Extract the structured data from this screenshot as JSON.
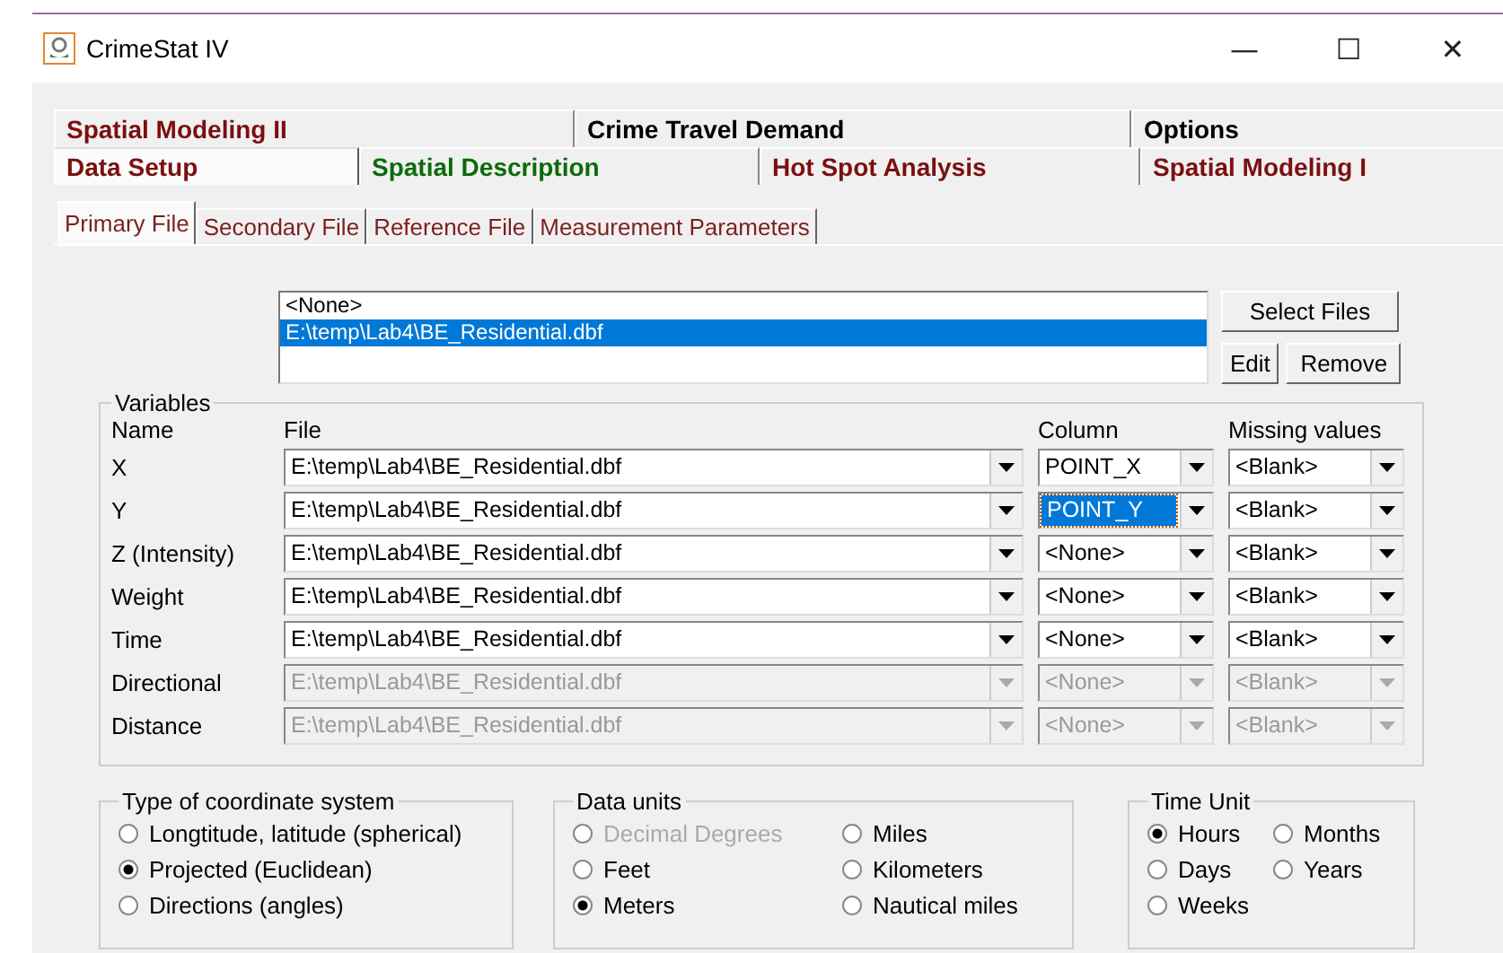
{
  "window": {
    "title": "CrimeStat IV",
    "controls": [
      "—",
      "☐",
      "✕"
    ]
  },
  "main_tabs": [
    [
      {
        "label": "Spatial Modeling II",
        "color": "#7b0f0f",
        "selected": false
      },
      {
        "label": "Crime Travel Demand",
        "color": "#000000",
        "selected": false
      },
      {
        "label": "Options",
        "color": "#000000",
        "selected": false
      }
    ],
    [
      {
        "label": "Data Setup",
        "color": "#7b0f0f",
        "selected": true
      },
      {
        "label": "Spatial Description",
        "color": "#0b6b0b",
        "selected": false
      },
      {
        "label": "Hot Spot Analysis",
        "color": "#7b0f0f",
        "selected": false
      },
      {
        "label": "Spatial Modeling I",
        "color": "#7b0f0f",
        "selected": false
      }
    ]
  ],
  "sub_tabs": [
    {
      "label": "Primary File",
      "selected": true
    },
    {
      "label": "Secondary File",
      "selected": false
    },
    {
      "label": "Reference File",
      "selected": false
    },
    {
      "label": "Measurement Parameters",
      "selected": false
    }
  ],
  "file_list": [
    {
      "label": "<None>",
      "selected": false
    },
    {
      "label": "E:\\temp\\Lab4\\BE_Residential.dbf",
      "selected": true
    }
  ],
  "file_buttons": [
    "Select Files",
    "Edit",
    "Remove"
  ],
  "variables": {
    "title": "Variables",
    "headers": [
      "Name",
      "File",
      "Column",
      "Missing values"
    ],
    "rows": [
      {
        "name": "X",
        "file": "E:\\temp\\Lab4\\BE_Residential.dbf",
        "column": "POINT_X",
        "missing": "<Blank>",
        "disabled": false,
        "column_focused": false
      },
      {
        "name": "Y",
        "file": "E:\\temp\\Lab4\\BE_Residential.dbf",
        "column": "POINT_Y",
        "missing": "<Blank>",
        "disabled": false,
        "column_focused": true
      },
      {
        "name": "Z (Intensity)",
        "file": "E:\\temp\\Lab4\\BE_Residential.dbf",
        "column": "<None>",
        "missing": "<Blank>",
        "disabled": false,
        "column_focused": false
      },
      {
        "name": "Weight",
        "file": "E:\\temp\\Lab4\\BE_Residential.dbf",
        "column": "<None>",
        "missing": "<Blank>",
        "disabled": false,
        "column_focused": false
      },
      {
        "name": "Time",
        "file": "E:\\temp\\Lab4\\BE_Residential.dbf",
        "column": "<None>",
        "missing": "<Blank>",
        "disabled": false,
        "column_focused": false
      },
      {
        "name": "Directional",
        "file": "E:\\temp\\Lab4\\BE_Residential.dbf",
        "column": "<None>",
        "missing": "<Blank>",
        "disabled": true,
        "column_focused": false
      },
      {
        "name": "Distance",
        "file": "E:\\temp\\Lab4\\BE_Residential.dbf",
        "column": "<None>",
        "missing": "<Blank>",
        "disabled": true,
        "column_focused": false
      }
    ]
  },
  "option_groups": [
    {
      "title": "Type of coordinate system",
      "options": [
        {
          "label": "Longtitude, latitude (spherical)",
          "selected": false,
          "disabled": false
        },
        {
          "label": "Projected (Euclidean)",
          "selected": true,
          "disabled": false
        },
        {
          "label": "Directions (angles)",
          "selected": false,
          "disabled": false
        }
      ]
    },
    {
      "title": "Data units",
      "options": [
        {
          "label": "Decimal Degrees",
          "selected": false,
          "disabled": true
        },
        {
          "label": "Miles",
          "selected": false,
          "disabled": false
        },
        {
          "label": "Feet",
          "selected": false,
          "disabled": false
        },
        {
          "label": "Kilometers",
          "selected": false,
          "disabled": false
        },
        {
          "label": "Meters",
          "selected": true,
          "disabled": false
        },
        {
          "label": "Nautical miles",
          "selected": false,
          "disabled": false
        }
      ]
    },
    {
      "title": "Time Unit",
      "options": [
        {
          "label": "Hours",
          "selected": true,
          "disabled": false
        },
        {
          "label": "Months",
          "selected": false,
          "disabled": false
        },
        {
          "label": "Days",
          "selected": false,
          "disabled": false
        },
        {
          "label": "Years",
          "selected": false,
          "disabled": false
        },
        {
          "label": "Weeks",
          "selected": false,
          "disabled": false
        }
      ]
    }
  ]
}
